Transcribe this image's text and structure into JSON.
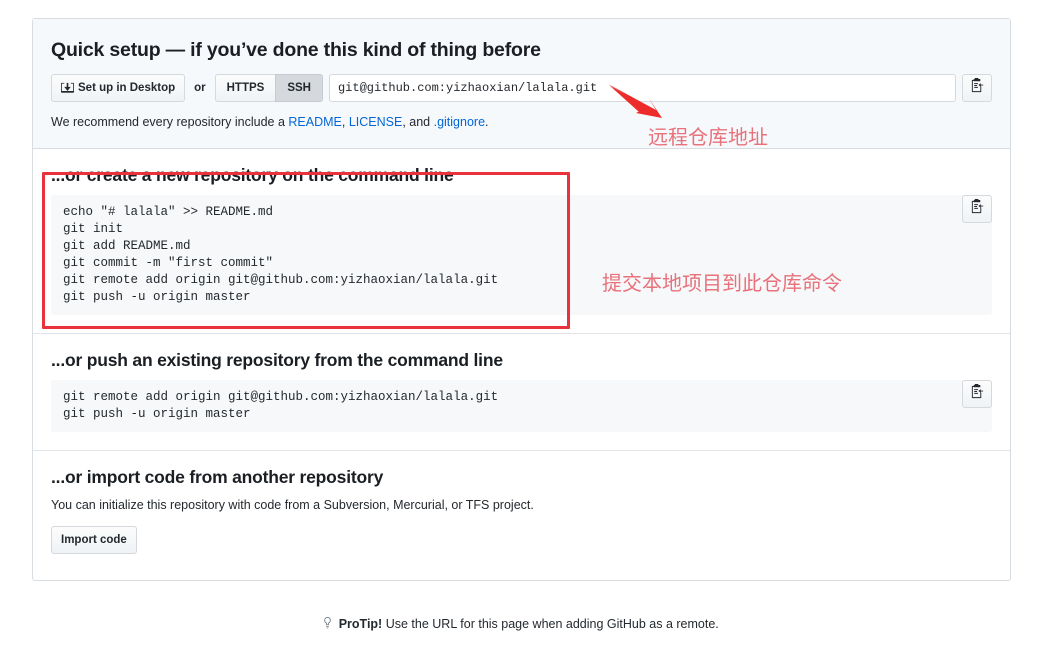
{
  "quick_setup": {
    "title": "Quick setup — if you’ve done this kind of thing before",
    "desktop_button": "Set up in Desktop",
    "or_label": "or",
    "protocols": [
      {
        "label": "HTTPS",
        "active": false
      },
      {
        "label": "SSH",
        "active": true
      }
    ],
    "clone_url": "git@github.com:yizhaoxian/lalala.git",
    "copy_icon": "clipboard-icon",
    "recommend": {
      "prefix": "We recommend every repository include a ",
      "link_readme": "README",
      "sep1": ", ",
      "link_license": "LICENSE",
      "sep2": ", and ",
      "link_gitignore": ".gitignore",
      "suffix": "."
    }
  },
  "create_section": {
    "title": "...or create a new repository on the command line",
    "code": "echo \"# lalala\" >> README.md\ngit init\ngit add README.md\ngit commit -m \"first commit\"\ngit remote add origin git@github.com:yizhaoxian/lalala.git\ngit push -u origin master",
    "copy_icon": "clipboard-icon"
  },
  "push_section": {
    "title": "...or push an existing repository from the command line",
    "code": "git remote add origin git@github.com:yizhaoxian/lalala.git\ngit push -u origin master",
    "copy_icon": "clipboard-icon"
  },
  "import_section": {
    "title": "...or import code from another repository",
    "subtitle": "You can initialize this repository with code from a Subversion, Mercurial, or TFS project.",
    "button": "Import code"
  },
  "protip": {
    "icon": "lightbulb-icon",
    "label": "ProTip!",
    "text": "Use the URL for this page when adding GitHub as a remote."
  },
  "annotations": {
    "url_note": "远程仓库地址",
    "command_note": "提交本地项目到此仓库命令",
    "color": "#e8717a",
    "box_color": "#e8323c",
    "arrow_color": "#ee2b2b"
  },
  "colors": {
    "link": "#0366d6",
    "panel_header_bg": "#f6f9fc",
    "code_bg": "#f6f8fa",
    "border": "#d8dde2"
  }
}
